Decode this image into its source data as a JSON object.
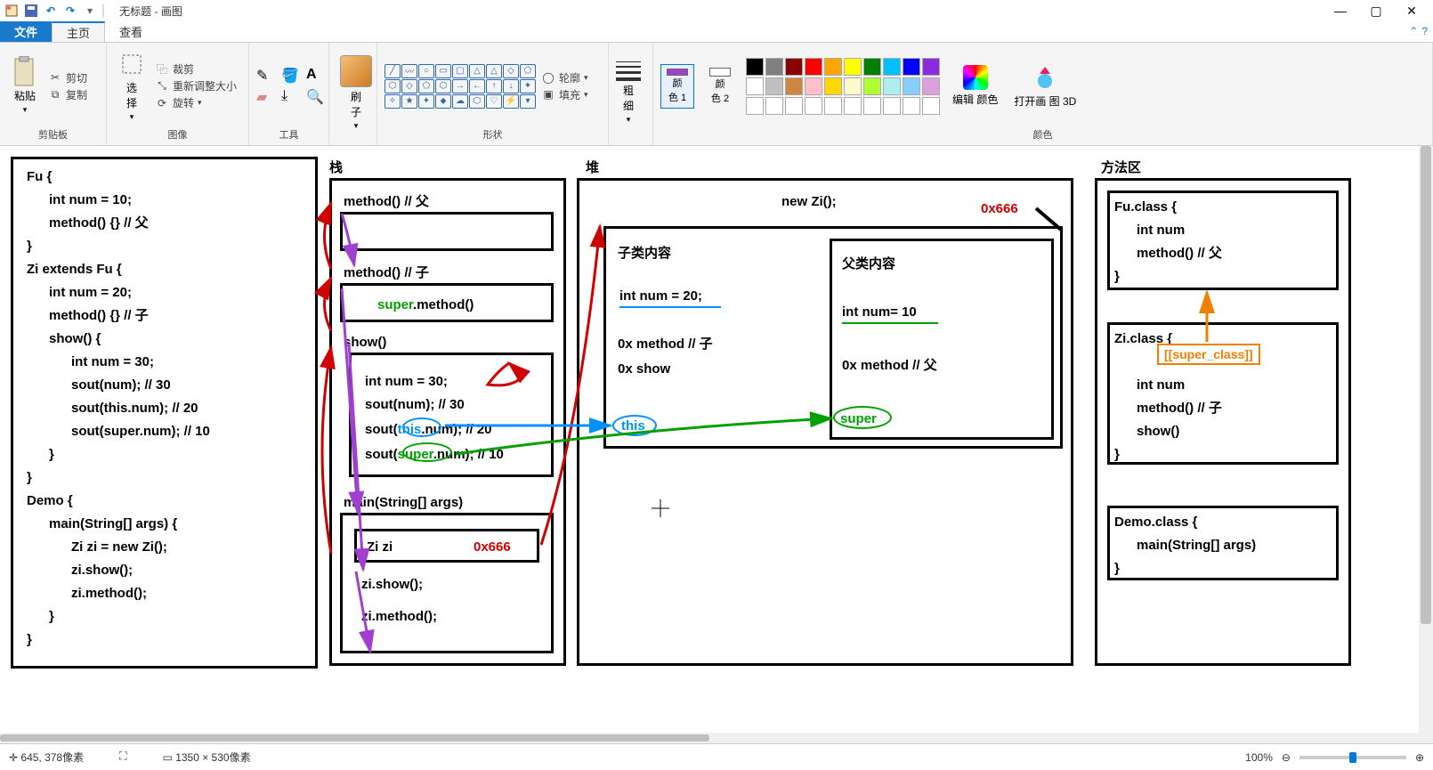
{
  "title": "无标题 - 画图",
  "tabs": {
    "file": "文件",
    "home": "主页",
    "view": "查看"
  },
  "ribbon": {
    "clipboard": {
      "paste": "粘贴",
      "cut": "剪切",
      "copy": "复制",
      "label": "剪贴板"
    },
    "image": {
      "select": "选\n择",
      "crop": "裁剪",
      "resize": "重新调整大小",
      "rotate": "旋转",
      "label": "图像"
    },
    "tools": {
      "label": "工具"
    },
    "brushes": {
      "sub": "刷\n子"
    },
    "shapes": {
      "outline": "轮廓",
      "fill": "填充",
      "label": "形状"
    },
    "thickness": {
      "label": "粗\n细"
    },
    "colors": {
      "c1": "颜\n色 1",
      "c2": "颜\n色 2",
      "edit": "编辑\n颜色",
      "open3d": "打开画\n图 3D",
      "label": "颜色"
    }
  },
  "palette": {
    "row1": [
      "#000000",
      "#808080",
      "#8B0000",
      "#FF0000",
      "#FFA500",
      "#FFFF00",
      "#008000",
      "#00BFFF",
      "#0000FF",
      "#8A2BE2"
    ],
    "row2": [
      "#FFFFFF",
      "#C0C0C0",
      "#CD853F",
      "#FFC0CB",
      "#FFD700",
      "#FFFACD",
      "#ADFF2F",
      "#AFEEEE",
      "#87CEFA",
      "#DDA0DD"
    ],
    "row3": [
      "#FFFFFF",
      "#FFFFFF",
      "#FFFFFF",
      "#FFFFFF",
      "#FFFFFF",
      "#FFFFFF",
      "#FFFFFF",
      "#FFFFFF",
      "#FFFFFF",
      "#FFFFFF"
    ]
  },
  "canvas": {
    "labels": {
      "stack": "栈",
      "heap": "堆",
      "methodArea": "方法区"
    },
    "code": "Fu {\n      int num = 10;\n      method() {} // 父\n}\nZi extends Fu {\n      int num = 20;\n      method() {} // 子\n      show() {\n            int num = 30;\n            sout(num); // 30\n            sout(this.num); // 20\n            sout(super.num); // 10\n      }\n}\nDemo {\n      main(String[] args) {\n            Zi zi = new Zi();\n            zi.show();\n            zi.method();\n      }\n}",
    "stack": {
      "f1": "method() // 父",
      "f2": "method() // 子",
      "f2body": "super.method()",
      "f2super": "super",
      "f3": "show()",
      "f3b1": "int num = 30;",
      "f3b2": "sout(num); // 30",
      "f3b3": "sout(this.num); // 20",
      "f3b4": "sout(super.num); // 10",
      "f3this": "this",
      "f3super": "super",
      "f4": "main(String[] args)",
      "f4v": "Zi zi",
      "f4addr": "0x666",
      "f4b1": "zi.show();",
      "f4b2": "zi.method();"
    },
    "heap": {
      "new": "new Zi();",
      "addr": "0x666",
      "childTitle": "子类内容",
      "childNum": "int num = 20;",
      "childM1": "0x method // 子",
      "childM2": "0x show",
      "parentTitle": "父类内容",
      "parentNum": "int num= 10",
      "parentM": "0x method // 父",
      "this": "this",
      "super": "super"
    },
    "method": {
      "fu": "Fu.class {\n      int num\n      method() // 父\n}",
      "zi": "Zi.class {\n\n      int num\n      method() // 子\n      show()\n}",
      "superClass": "[[super_class]]",
      "demo": "Demo.class {\n      main(String[] args)\n}"
    }
  },
  "status": {
    "coords": "645, 378像素",
    "size": "1350 × 530像素",
    "zoom": "100%"
  }
}
